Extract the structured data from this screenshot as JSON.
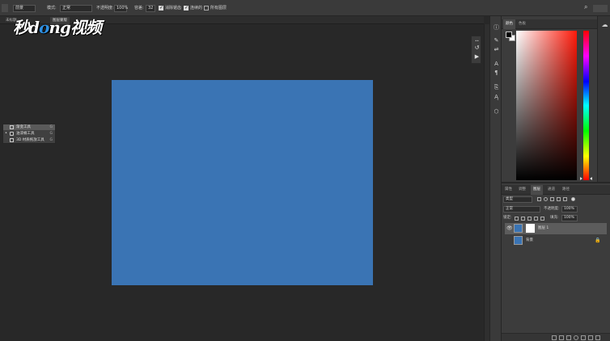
{
  "options_bar": {
    "tool_preset": "前景",
    "mode_label": "模式:",
    "mode_value": "正常",
    "opacity_label": "不透明度:",
    "opacity_value": "100%",
    "tolerance_label": "容差:",
    "tolerance_value": "32",
    "antialias_label": "消除锯齿",
    "antialias_checked": true,
    "contiguous_label": "连续的",
    "contiguous_checked": true,
    "all_layers_label": "所有图层",
    "all_layers_checked": false,
    "search_icon": "search-icon",
    "workspace_icon": "workspace-icon"
  },
  "tabs": [
    {
      "label": "未标题"
    },
    {
      "label": "图层蒙版"
    }
  ],
  "watermark": {
    "part1": "秒d",
    "part2": "ng视频",
    "o": "o"
  },
  "canvas": {
    "fill_color": "#3a74b4"
  },
  "tool_flyout": {
    "items": [
      {
        "label": "渐变工具",
        "key": "G",
        "selected": true
      },
      {
        "label": "油漆桶工具",
        "key": "G",
        "selected": false,
        "current": true
      },
      {
        "label": "3D 材质拖放工具",
        "key": "G",
        "selected": false
      }
    ]
  },
  "color_panel": {
    "tabs": [
      {
        "label": "颜色",
        "active": true
      },
      {
        "label": "色板",
        "active": false
      }
    ],
    "foreground": "#000000",
    "background": "#ffffff"
  },
  "layers_panel": {
    "tabs": [
      {
        "label": "属性",
        "active": false
      },
      {
        "label": "调整",
        "active": false
      },
      {
        "label": "图层",
        "active": true
      },
      {
        "label": "通道",
        "active": false
      },
      {
        "label": "路径",
        "active": false
      }
    ],
    "filter_label": "类型",
    "blend_mode": "正常",
    "opacity_label": "不透明度:",
    "opacity_value": "100%",
    "lock_label": "锁定:",
    "fill_label": "填充:",
    "fill_value": "100%",
    "layers": [
      {
        "name": "图层 1",
        "visible": true,
        "selected": true,
        "has_mask": true
      },
      {
        "name": "背景",
        "visible": false,
        "selected": false,
        "locked": true
      }
    ]
  }
}
